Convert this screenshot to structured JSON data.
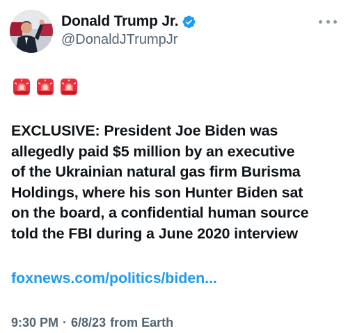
{
  "author": {
    "display_name": "Donald Trump Jr.",
    "handle": "@DonaldJTrumpJr",
    "verified": true,
    "verified_color": "#1d9bf0"
  },
  "menu": {
    "icon": "more-horizontal-icon"
  },
  "emoji": {
    "name": "police-car-light-emoji",
    "count": 3
  },
  "tweet": {
    "lines": [
      "EXCLUSIVE: President Joe Biden was",
      "allegedly paid $5 million by an executive",
      "of the Ukrainian natural gas firm Burisma",
      "Holdings, where his son Hunter Biden sat",
      "on the board, a confidential human source",
      "told the FBI during a June 2020 interview"
    ],
    "link_text": "foxnews.com/politics/biden...",
    "link_color": "#1d9bf0"
  },
  "meta": {
    "time": "9:30 PM",
    "separator": "·",
    "date": "6/8/23",
    "source": "from Earth"
  }
}
